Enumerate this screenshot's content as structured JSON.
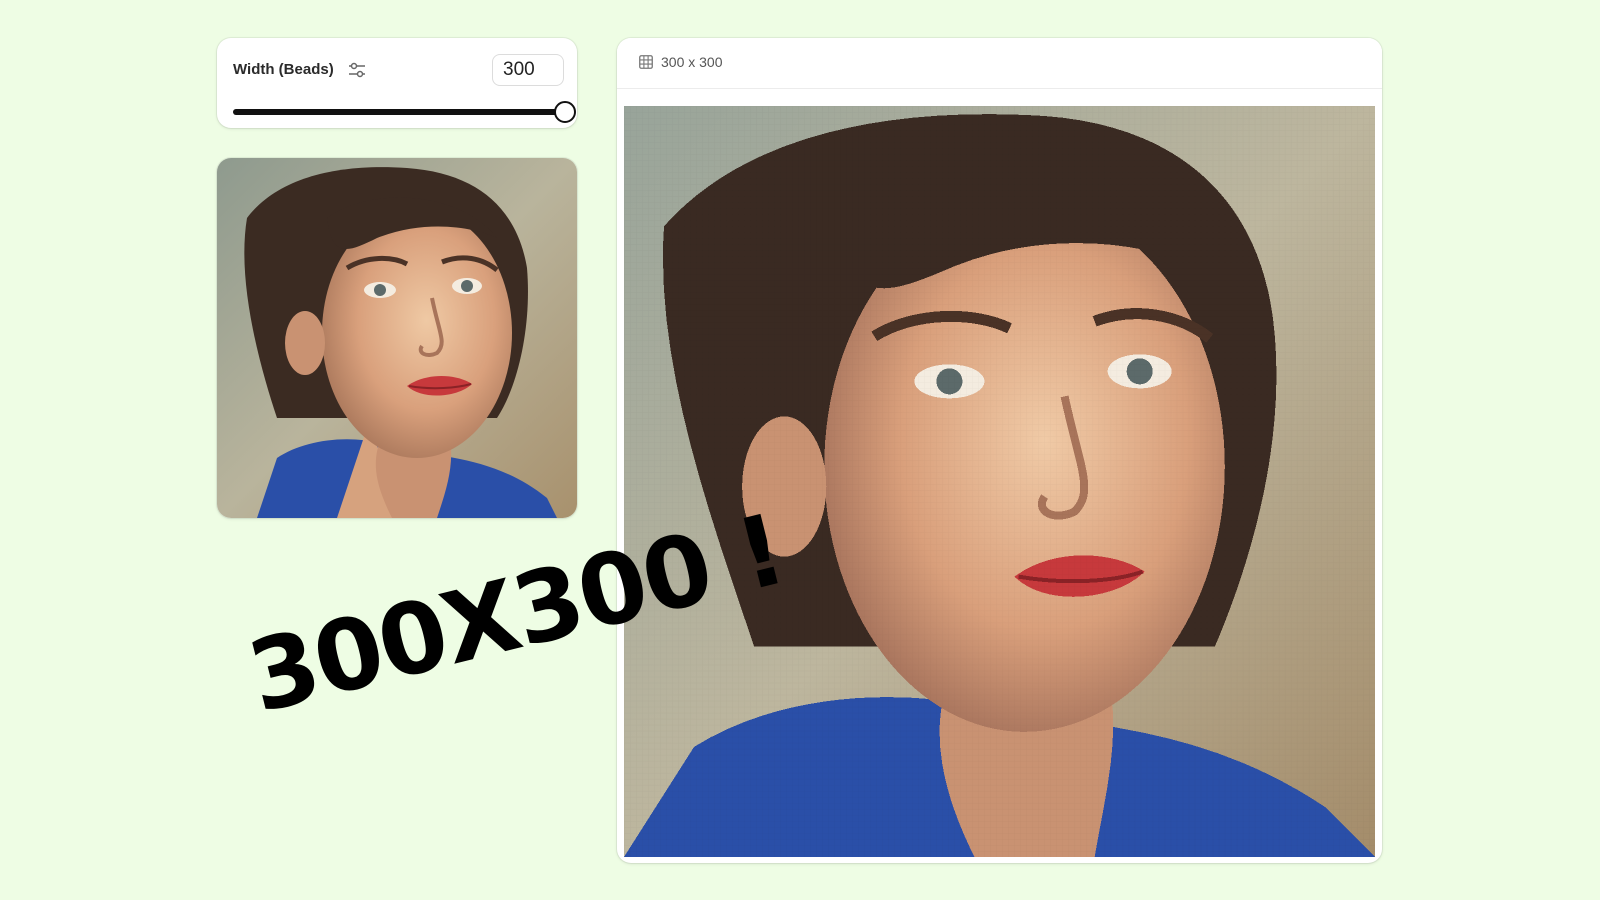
{
  "width_control": {
    "label": "Width (Beads)",
    "value": "300",
    "icon": "sliders-icon",
    "slider": {
      "min": 0,
      "max": 300,
      "value": 300,
      "fill_fraction": 1.0
    }
  },
  "preview": {
    "grid_icon": "grid-icon",
    "size_label": "300 x 300"
  },
  "annotation": {
    "text": "300X300 !"
  },
  "colors": {
    "background": "#eefde4",
    "card": "#ffffff",
    "slider_fill": "#111111",
    "jacket_blue": "#2a4fa8",
    "skin": "#e3b58f",
    "hair": "#3a2a22",
    "lips": "#c7393c"
  }
}
